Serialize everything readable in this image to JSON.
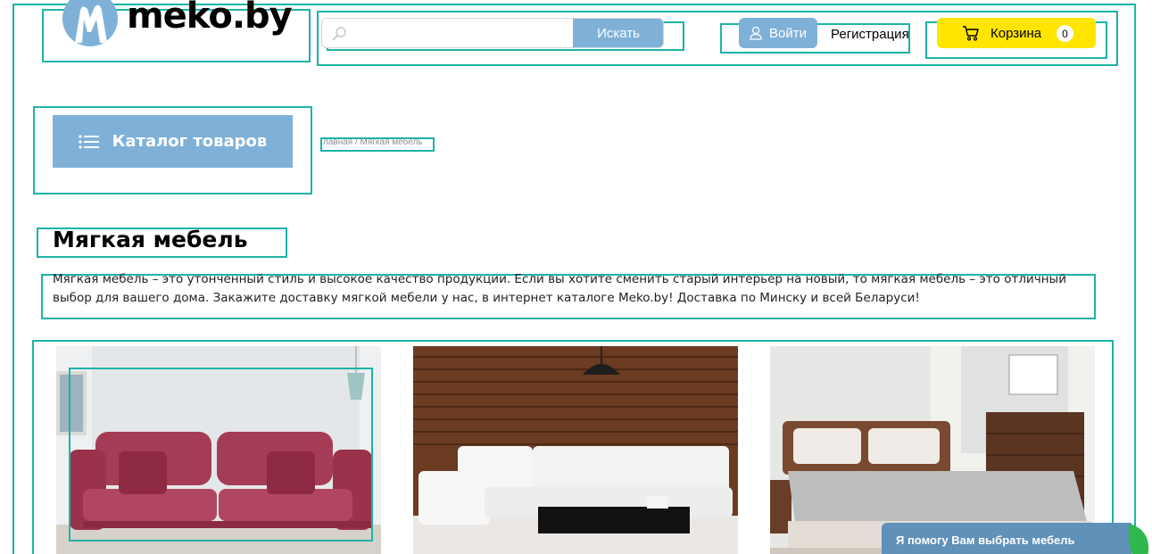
{
  "header": {
    "logo_text": "meko.by",
    "search": {
      "placeholder": "",
      "value": "",
      "button_label": "Искать"
    },
    "login_label": "Войти",
    "register_label": "Регистрация",
    "cart": {
      "label": "Корзина",
      "count": "0"
    }
  },
  "catalog_button_label": "Каталог товаров",
  "breadcrumb": "лавная / Мягкая мебель",
  "page": {
    "title": "Мягкая мебель",
    "intro": "Мягкая мебель – это утонченный стиль и высокое качество продукции. Если вы хотите сменить старый интерьер на новый, то мягкая мебель – это отличный выбор для вашего дома. Закажите доставку мягкой мебели у нас, в интернет каталоге Meko.by! Доставка по Минску и всей Беларуси!"
  },
  "products": [
    {
      "image": "red-sofa"
    },
    {
      "image": "white-corner-sofa"
    },
    {
      "image": "bed"
    }
  ],
  "help_banner": "Я помогу Вам выбрать мебель",
  "colors": {
    "accent_blue": "#7fb1d8",
    "cart_yellow": "#ffe500",
    "outline_teal": "#1cb3a8"
  }
}
